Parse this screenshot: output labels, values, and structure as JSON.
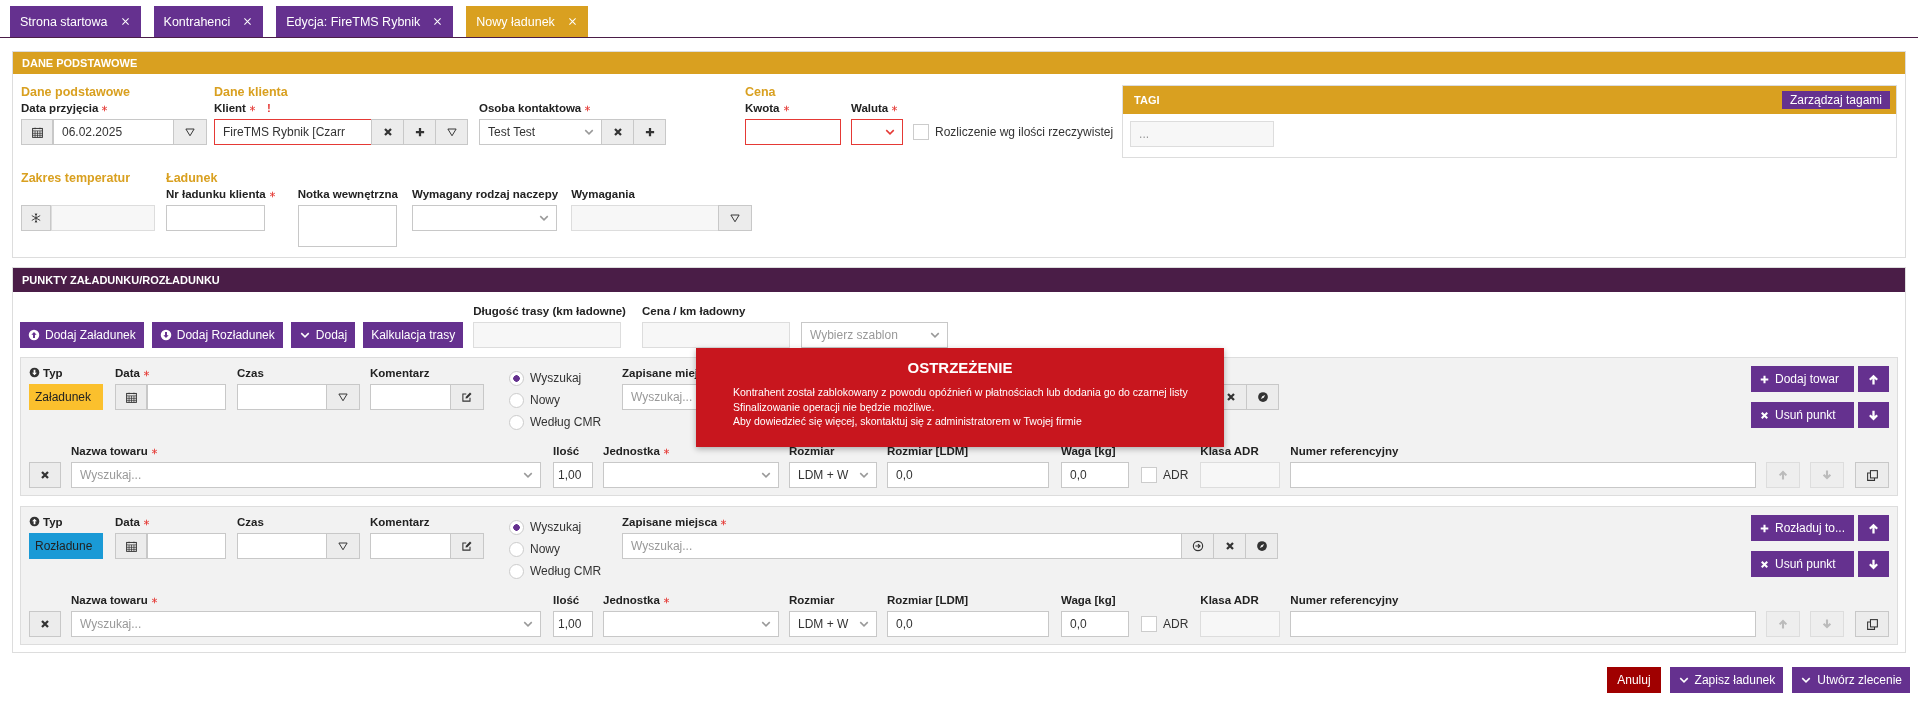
{
  "tabs": [
    {
      "label": "Strona startowa",
      "selected": false
    },
    {
      "label": "Kontrahenci",
      "selected": false
    },
    {
      "label": "Edycja: FireTMS Rybnik",
      "selected": false
    },
    {
      "label": "Nowy ładunek",
      "selected": true
    }
  ],
  "basic": {
    "title": "DANE PODSTAWOWE",
    "acceptance": {
      "heading": "Dane podstawowe",
      "label": "Data przyjęcia",
      "required": true,
      "value": "06.02.2025"
    },
    "client": {
      "heading": "Dane klienta",
      "label": "Klient",
      "required": true,
      "warning": "!",
      "value": "FireTMS Rybnik [Czarr",
      "invalid": true
    },
    "contact": {
      "label": "Osoba kontaktowa",
      "required": true,
      "value": "Test Test"
    },
    "price": {
      "heading": "Cena",
      "amount": {
        "label": "Kwota",
        "required": true,
        "invalid": true
      },
      "currency": {
        "label": "Waluta",
        "required": true,
        "invalid": true
      },
      "actual_quantity": {
        "label": "Rozliczenie wg ilości rzeczywistej",
        "checked": false
      }
    },
    "tags": {
      "title": "TAGI",
      "button": "Zarządzaj tagami",
      "placeholder": "..."
    },
    "temperature": {
      "heading": "Zakres temperatur",
      "disabled": true
    },
    "cargo": {
      "heading": "Ładunek",
      "client_number": {
        "label": "Nr ładunku klienta",
        "required": true
      },
      "note": {
        "label": "Notka wewnętrzna"
      },
      "trailer": {
        "label": "Wymagany rodzaj naczepy"
      },
      "requirements": {
        "label": "Wymagania",
        "disabled": true
      }
    }
  },
  "points": {
    "title": "PUNKTY ZAŁADUNKU/ROZŁADUNKU",
    "toolbar": [
      {
        "kind": "load",
        "label": "Dodaj Załadunek"
      },
      {
        "kind": "unload",
        "label": "Dodaj Rozładunek"
      },
      {
        "kind": "more",
        "label": "Dodaj"
      },
      {
        "kind": "plain",
        "label": "Kalkulacja trasy"
      }
    ],
    "route_length": {
      "label": "Długość trasy (km ładowne)",
      "disabled": true
    },
    "price_per_km": {
      "label": "Cena / km ładowny",
      "disabled": true
    },
    "template": {
      "placeholder": "Wybierz szablon"
    },
    "stops": [
      {
        "kind": "load",
        "type_label": "Typ",
        "type": "Załadunek",
        "date": {
          "label": "Data",
          "required": true
        },
        "time": {
          "label": "Czas"
        },
        "comment": {
          "label": "Komentarz"
        },
        "modes": [
          {
            "label": "Wyszukaj",
            "selected": true
          },
          {
            "label": "Nowy",
            "selected": false
          },
          {
            "label": "Według CMR",
            "selected": false
          }
        ],
        "place": {
          "label": "Zapisane miej",
          "placeholder": "Wyszukaj...",
          "buttons": [
            {
              "kind": "clear"
            },
            {
              "kind": "locate"
            }
          ]
        },
        "add_button": "Dodaj towar",
        "remove_button": "Usuń punkt",
        "goods": {
          "name": {
            "label": "Nazwa towaru",
            "required": true,
            "placeholder": "Wyszukaj..."
          },
          "quantity": {
            "label": "Ilość",
            "value": "1,00"
          },
          "unit": {
            "label": "Jednostka",
            "required": true
          },
          "size": {
            "label": "Rozmiar",
            "value": "LDM + W"
          },
          "ldm": {
            "label": "Rozmiar [LDM]",
            "value": "0,0"
          },
          "weight": {
            "label": "Waga [kg]",
            "value": "0,0"
          },
          "adr": {
            "label": "ADR",
            "checked": false
          },
          "adr_class": {
            "label": "Klasa ADR"
          },
          "reference": {
            "label": "Numer referencyjny"
          },
          "reorder_disabled": true
        }
      },
      {
        "kind": "unload",
        "type_label": "Typ",
        "type": "Rozładune",
        "date": {
          "label": "Data",
          "required": true
        },
        "time": {
          "label": "Czas"
        },
        "comment": {
          "label": "Komentarz"
        },
        "modes": [
          {
            "label": "Wyszukaj",
            "selected": true
          },
          {
            "label": "Nowy",
            "selected": false
          },
          {
            "label": "Według CMR",
            "selected": false
          }
        ],
        "place": {
          "label": "Zapisane miejsca",
          "required": true,
          "placeholder": "Wyszukaj...",
          "buttons": [
            {
              "kind": "go"
            },
            {
              "kind": "clear"
            },
            {
              "kind": "locate"
            }
          ]
        },
        "add_button": "Rozładuj to...",
        "remove_button": "Usuń punkt",
        "goods": {
          "name": {
            "label": "Nazwa towaru",
            "required": true,
            "placeholder": "Wyszukaj..."
          },
          "quantity": {
            "label": "Ilość",
            "value": "1,00"
          },
          "unit": {
            "label": "Jednostka",
            "required": true
          },
          "size": {
            "label": "Rozmiar",
            "value": "LDM + W"
          },
          "ldm": {
            "label": "Rozmiar [LDM]",
            "value": "0,0"
          },
          "weight": {
            "label": "Waga [kg]",
            "value": "0,0"
          },
          "adr": {
            "label": "ADR",
            "checked": false
          },
          "adr_class": {
            "label": "Klasa ADR"
          },
          "reference": {
            "label": "Numer referencyjny"
          },
          "reorder_disabled": true
        }
      }
    ]
  },
  "warning": {
    "title": "OSTRZEŻENIE",
    "lines": [
      "Kontrahent został zablokowany z powodu opóźnień w płatnościach lub dodania go do czarnej listy",
      "Sfinalizowanie operacji nie będzie możliwe.",
      "Aby dowiedzieć się więcej, skontaktuj się z administratorem w Twojej firmie"
    ]
  },
  "footer": [
    {
      "kind": "cancel",
      "label": "Anuluj"
    },
    {
      "kind": "save",
      "label": "Zapisz ładunek"
    },
    {
      "kind": "save",
      "label": "Utwórz zlecenie"
    }
  ]
}
